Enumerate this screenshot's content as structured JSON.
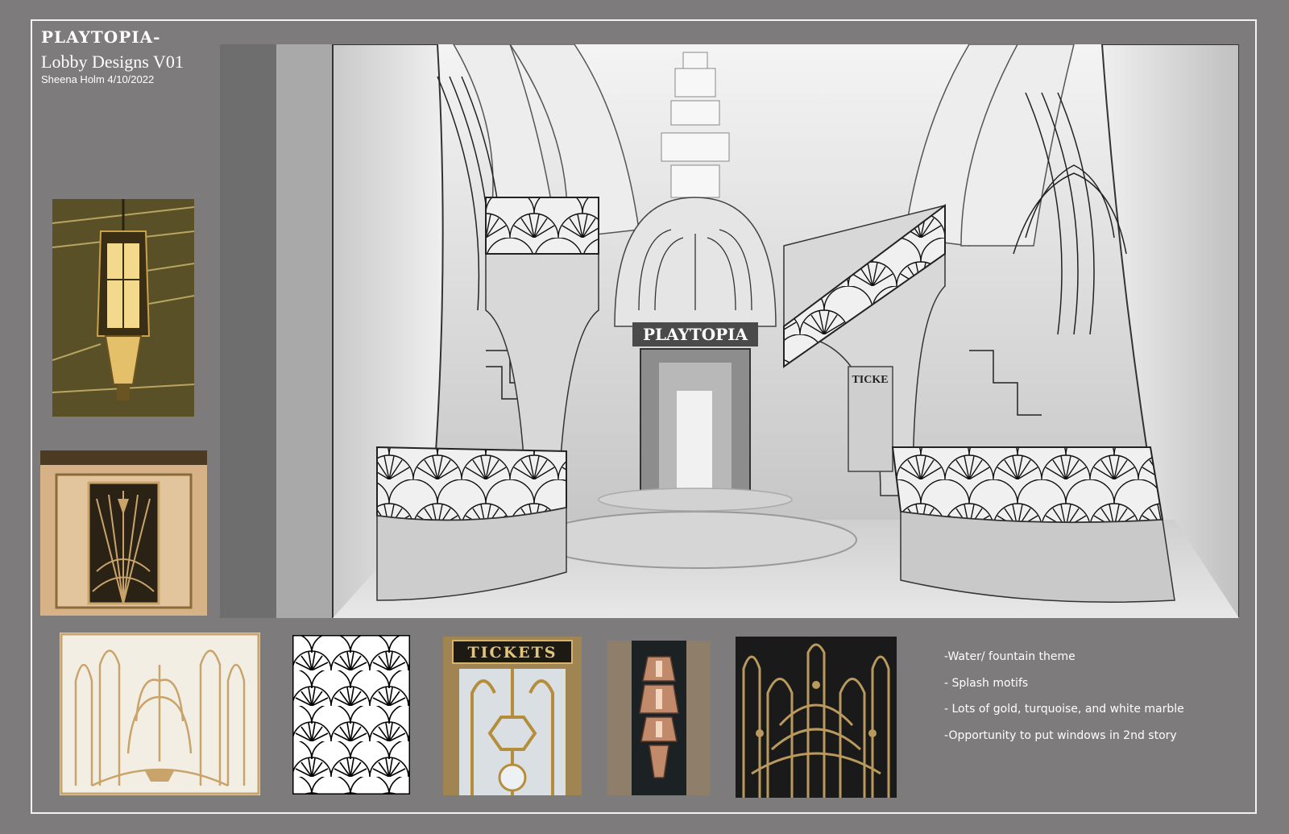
{
  "header": {
    "brand": "PLAYTOPIA-",
    "subtitle": "Lobby Designs V01",
    "author_line": "Sheena Holm 4/10/2022"
  },
  "render": {
    "sign_text": "PLAYTOPIA",
    "ticket_sign": "TICKE"
  },
  "references": {
    "tickets_sign": "TICKETS"
  },
  "notes": [
    "-Water/ fountain theme",
    "- Splash motifs",
    "- Lots of gold, turquoise, and white marble",
    "-Opportunity to put windows in 2nd story"
  ],
  "colors": {
    "background": "#7d7b7c",
    "frame": "#f2f2f2",
    "gold": "#c9a46a",
    "dark_gold": "#6b5322",
    "marble": "#e9e9e9"
  }
}
